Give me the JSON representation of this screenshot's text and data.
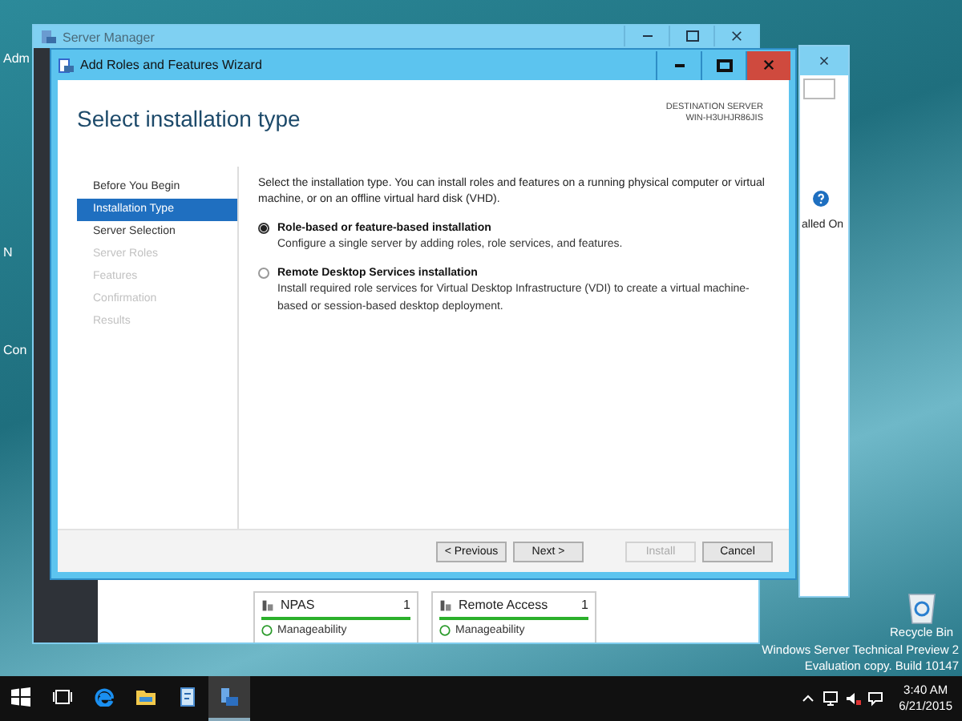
{
  "desktop": {
    "edge_labels": [
      {
        "text": "Adm"
      },
      {
        "text": "N"
      },
      {
        "text": "Con"
      }
    ],
    "recycle_bin": "Recycle Bin",
    "os_lines": [
      "Windows Server Technical Preview 2",
      "Evaluation copy. Build 10147"
    ]
  },
  "back_window": {
    "partial_label": "alled On"
  },
  "server_manager": {
    "title": "Server Manager",
    "tiles": [
      {
        "name": "NPAS",
        "count": "1",
        "status": "Manageability"
      },
      {
        "name": "Remote Access",
        "count": "1",
        "status": "Manageability"
      }
    ]
  },
  "wizard": {
    "title": "Add Roles and Features Wizard",
    "heading": "Select installation type",
    "destination_label": "DESTINATION SERVER",
    "destination_server": "WIN-H3UHJR86JIS",
    "steps": [
      {
        "label": "Before You Begin",
        "selected": false,
        "disabled": false
      },
      {
        "label": "Installation Type",
        "selected": true,
        "disabled": false
      },
      {
        "label": "Server Selection",
        "selected": false,
        "disabled": false
      },
      {
        "label": "Server Roles",
        "selected": false,
        "disabled": true
      },
      {
        "label": "Features",
        "selected": false,
        "disabled": true
      },
      {
        "label": "Confirmation",
        "selected": false,
        "disabled": true
      },
      {
        "label": "Results",
        "selected": false,
        "disabled": true
      }
    ],
    "intro": "Select the installation type. You can install roles and features on a running physical computer or virtual machine, or on an offline virtual hard disk (VHD).",
    "options": [
      {
        "title": "Role-based or feature-based installation",
        "description": "Configure a single server by adding roles, role services, and features.",
        "selected": true
      },
      {
        "title": "Remote Desktop Services installation",
        "description": "Install required role services for Virtual Desktop Infrastructure (VDI) to create a virtual machine-based or session-based desktop deployment.",
        "selected": false
      }
    ],
    "buttons": [
      {
        "label": "< Previous",
        "disabled": false
      },
      {
        "label": "Next >",
        "disabled": false
      },
      {
        "label": "Install",
        "disabled": true
      },
      {
        "label": "Cancel",
        "disabled": false
      }
    ]
  },
  "taskbar": {
    "apps": [
      {
        "kind": "start",
        "selected": false
      },
      {
        "kind": "taskview",
        "selected": false
      },
      {
        "kind": "browser",
        "selected": false
      },
      {
        "kind": "folder",
        "selected": false
      },
      {
        "kind": "server",
        "selected": false
      },
      {
        "kind": "manager",
        "selected": true
      }
    ],
    "time": "3:40 AM",
    "date": "6/21/2015"
  }
}
